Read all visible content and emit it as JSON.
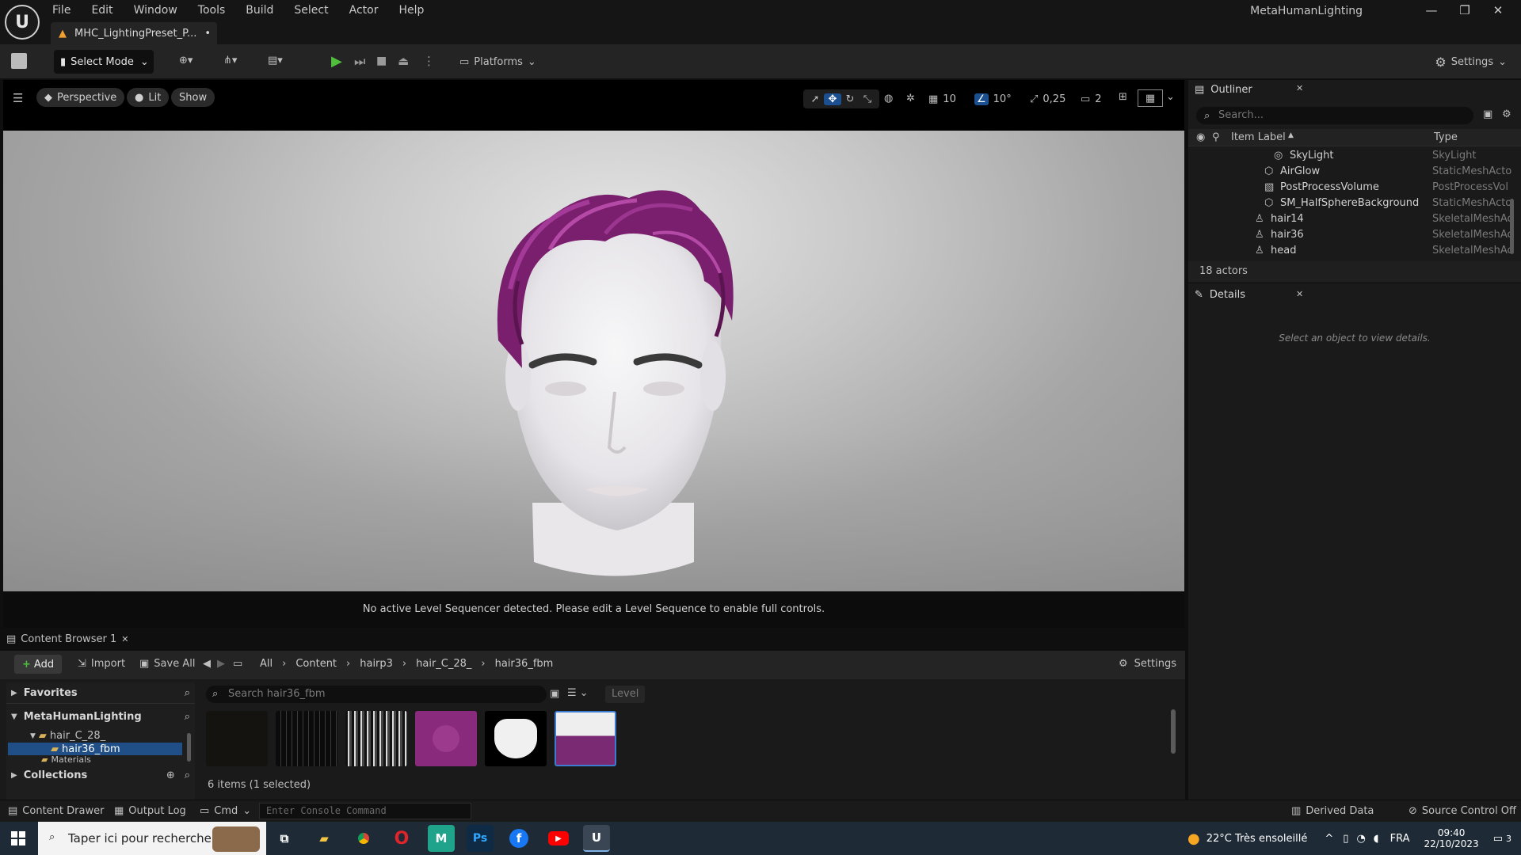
{
  "app": {
    "window_title": "MetaHumanLighting",
    "document_tab": "MHC_LightingPreset_P...",
    "document_dirty_marker": "•",
    "menu": [
      "File",
      "Edit",
      "Window",
      "Tools",
      "Build",
      "Select",
      "Actor",
      "Help"
    ]
  },
  "toolbar": {
    "select_mode": "Select Mode",
    "platforms": "Platforms",
    "settings": "Settings"
  },
  "viewport": {
    "perspective": "Perspective",
    "lit": "Lit",
    "show": "Show",
    "grid_snap": "10",
    "rotation_snap": "10°",
    "scale_snap": "0,25",
    "camera_speed": "2",
    "sequencer_message": "No active Level Sequencer detected. Please edit a Level Sequence to enable full controls."
  },
  "outliner": {
    "title": "Outliner",
    "search_placeholder": "Search...",
    "col_label": "Item Label",
    "col_type": "Type",
    "rows": [
      {
        "name": "SkyLight",
        "type": "SkyLight",
        "icon": "skylight-icon"
      },
      {
        "name": "AirGlow",
        "type": "StaticMeshActo",
        "icon": "static-mesh-icon"
      },
      {
        "name": "PostProcessVolume",
        "type": "PostProcessVol",
        "icon": "post-process-icon"
      },
      {
        "name": "SM_HalfSphereBackground",
        "type": "StaticMeshActo",
        "icon": "static-mesh-icon"
      },
      {
        "name": "hair14",
        "type": "SkeletalMeshAc",
        "icon": "skeletal-mesh-icon"
      },
      {
        "name": "hair36",
        "type": "SkeletalMeshAc",
        "icon": "skeletal-mesh-icon"
      },
      {
        "name": "head",
        "type": "SkeletalMeshAc",
        "icon": "skeletal-mesh-icon"
      }
    ],
    "actor_count": "18 actors"
  },
  "details": {
    "title": "Details",
    "empty_message": "Select an object to view details."
  },
  "content_browser": {
    "tab": "Content Browser 1",
    "add": "Add",
    "import": "Import",
    "save_all": "Save All",
    "breadcrumb": [
      "All",
      "Content",
      "hairp3",
      "hair_C_28_",
      "hair36_fbm"
    ],
    "settings": "Settings",
    "favorites": "Favorites",
    "project": "MetaHumanLighting",
    "tree": [
      {
        "label": "hair_C_28_",
        "selected": false
      },
      {
        "label": "hair36_fbm",
        "selected": true
      },
      {
        "label": "Materials",
        "selected": false
      }
    ],
    "collections": "Collections",
    "search_placeholder": "Search hair36_fbm",
    "filter_level": "Level",
    "items_status": "6 items (1 selected)"
  },
  "statusbar": {
    "content_drawer": "Content Drawer",
    "output_log": "Output Log",
    "cmd": "Cmd",
    "console_placeholder": "Enter Console Command",
    "derived_data": "Derived Data",
    "source_control": "Source Control Off"
  },
  "taskbar": {
    "search_placeholder": "Taper ici pour rechercher",
    "weather": "22°C  Très ensoleillé",
    "language": "FRA",
    "time": "09:40",
    "date": "22/10/2023",
    "notifications": "3"
  }
}
